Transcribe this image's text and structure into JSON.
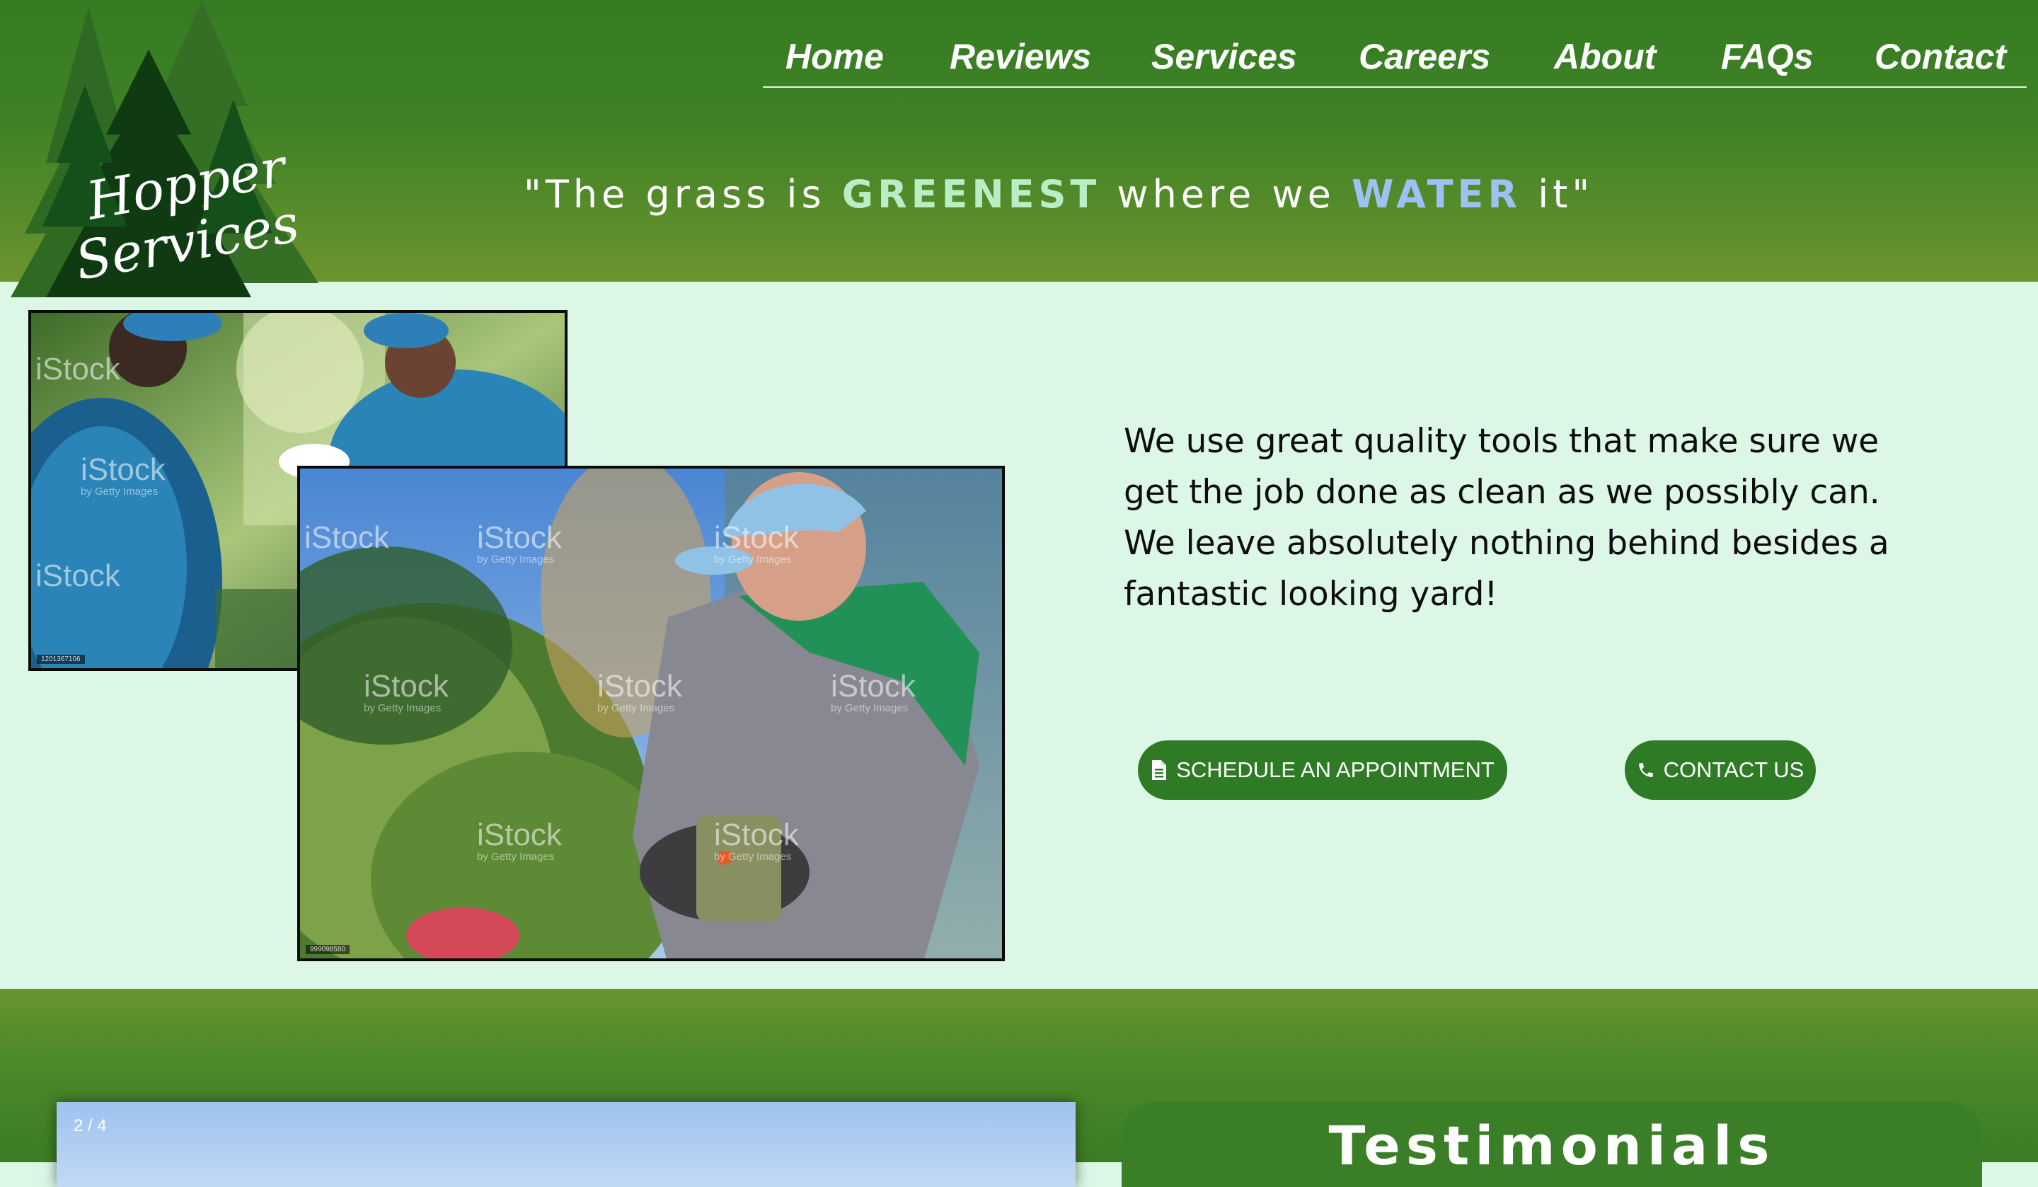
{
  "brand": {
    "logo_text_line1": "Hopper",
    "logo_text_line2": "Services"
  },
  "nav": {
    "items": [
      {
        "label": "Home"
      },
      {
        "label": "Reviews"
      },
      {
        "label": "Services"
      },
      {
        "label": "Careers"
      },
      {
        "label": "About"
      },
      {
        "label": "FAQs"
      },
      {
        "label": "Contact"
      }
    ]
  },
  "hero": {
    "tagline_part1": "\"The grass is ",
    "tagline_green": "GREENEST",
    "tagline_part2": " where we ",
    "tagline_blue": "WATER",
    "tagline_part3": " it\""
  },
  "photos": {
    "watermark": "iStock",
    "watermark_sub": "by Getty Images",
    "team_id": "1201367106",
    "gardener_id": "999098580"
  },
  "content": {
    "description": "We use great quality tools that make sure we get the job done as clean as we possibly can. We leave absolutely nothing behind besides a fantastic looking yard!"
  },
  "buttons": {
    "schedule": {
      "label": "SCHEDULE AN APPOINTMENT",
      "icon": "document-icon"
    },
    "contact": {
      "label": "CONTACT US",
      "icon": "phone-icon"
    }
  },
  "slideshow": {
    "counter": "2 / 4"
  },
  "testimonials": {
    "title": "Testimonials"
  },
  "colors": {
    "header_green": "#357c22",
    "accent_green": "#2f7a25",
    "light_bg": "#dcf7e6",
    "tagline_green": "#b8eec6",
    "tagline_blue": "#9cc2f5"
  }
}
